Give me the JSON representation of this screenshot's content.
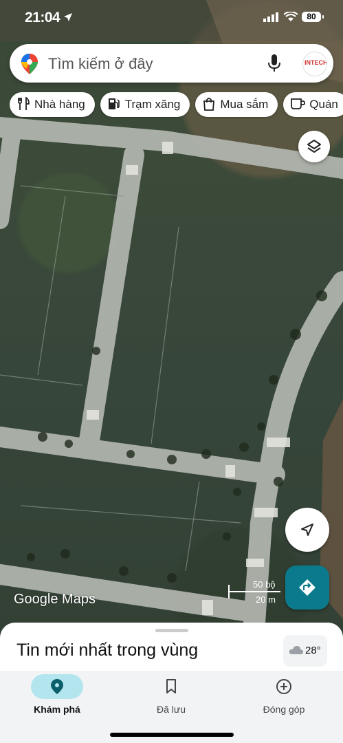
{
  "status_bar": {
    "time": "21:04",
    "battery": "80"
  },
  "search": {
    "placeholder": "Tìm kiếm ở đây",
    "avatar_text": "INTECH"
  },
  "chips": [
    {
      "label": "Nhà hàng",
      "icon": "restaurant-icon"
    },
    {
      "label": "Trạm xăng",
      "icon": "gas-station-icon"
    },
    {
      "label": "Mua sắm",
      "icon": "shopping-bag-icon"
    },
    {
      "label": "Quán",
      "icon": "coffee-icon"
    }
  ],
  "map": {
    "logo": "Google Maps",
    "scale_top": "50 bộ",
    "scale_bottom": "20 m",
    "type": "satellite"
  },
  "sheet": {
    "title": "Tin mới nhất trong vùng",
    "weather": "28°"
  },
  "bottom_nav": [
    {
      "label": "Khám phá",
      "icon": "explore-pin-icon",
      "active": true
    },
    {
      "label": "Đã lưu",
      "icon": "bookmark-icon",
      "active": false
    },
    {
      "label": "Đóng góp",
      "icon": "add-circle-icon",
      "active": false
    }
  ],
  "colors": {
    "accent": "#0b7a8c",
    "active_pill": "#b3e5ee"
  }
}
